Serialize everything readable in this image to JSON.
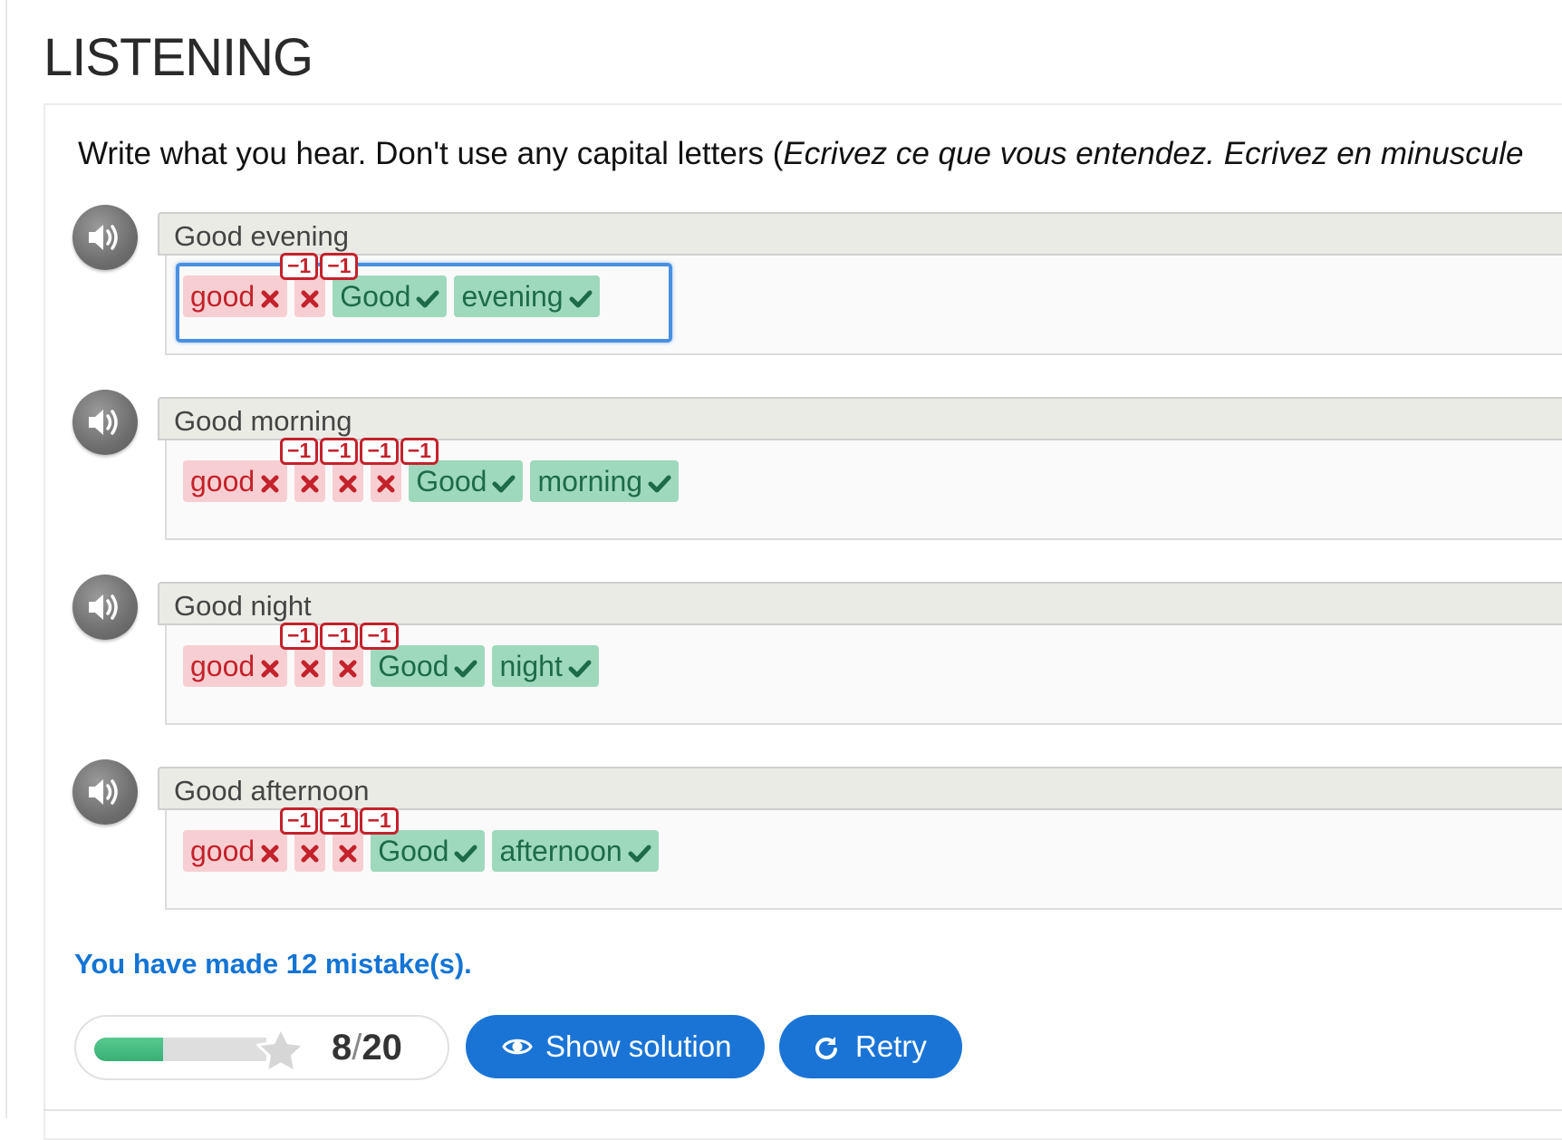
{
  "page": {
    "title": "LISTENING"
  },
  "instructions": {
    "text": "Write what you hear. Don't use any capital letters (",
    "italic": "Ecrivez ce que vous entendez. Ecrivez en minuscule"
  },
  "exercises": [
    {
      "prompt": "Good evening",
      "tokens": [
        {
          "text": "good",
          "status": "wrong"
        },
        {
          "text": "",
          "status": "wrong"
        },
        {
          "text": "Good",
          "status": "correct"
        },
        {
          "text": "evening",
          "status": "correct"
        }
      ],
      "penalties": [
        "−1",
        "−1"
      ]
    },
    {
      "prompt": "Good morning",
      "tokens": [
        {
          "text": "good",
          "status": "wrong"
        },
        {
          "text": "",
          "status": "wrong"
        },
        {
          "text": "",
          "status": "wrong"
        },
        {
          "text": "",
          "status": "wrong"
        },
        {
          "text": "Good",
          "status": "correct"
        },
        {
          "text": "morning",
          "status": "correct"
        }
      ],
      "penalties": [
        "−1",
        "−1",
        "−1",
        "−1"
      ]
    },
    {
      "prompt": "Good night",
      "tokens": [
        {
          "text": "good",
          "status": "wrong"
        },
        {
          "text": "",
          "status": "wrong"
        },
        {
          "text": "",
          "status": "wrong"
        },
        {
          "text": "Good",
          "status": "correct"
        },
        {
          "text": "night",
          "status": "correct"
        }
      ],
      "penalties": [
        "−1",
        "−1",
        "−1"
      ]
    },
    {
      "prompt": "Good afternoon",
      "tokens": [
        {
          "text": "good",
          "status": "wrong"
        },
        {
          "text": "",
          "status": "wrong"
        },
        {
          "text": "",
          "status": "wrong"
        },
        {
          "text": "Good",
          "status": "correct"
        },
        {
          "text": "afternoon",
          "status": "correct"
        }
      ],
      "penalties": [
        "−1",
        "−1",
        "−1"
      ]
    }
  ],
  "icons": {
    "audio": "speaker-icon",
    "wrong": "cross-icon",
    "correct": "check-icon",
    "star": "star-icon",
    "solution": "eye-icon",
    "retry": "refresh-icon"
  },
  "result": {
    "text": "You have made 12 mistake(s)."
  },
  "score": {
    "value": "8",
    "separator": "/",
    "max": "20",
    "progress": 0.4
  },
  "buttons": {
    "show_solution": "Show solution",
    "retry": "Retry"
  },
  "colors": {
    "wrong_bg": "#f7cfd2",
    "wrong_text": "#c3222c",
    "correct_bg": "#9fd9bd",
    "correct_text": "#1e6b47",
    "accent": "#1a74d6",
    "focus": "#4a90e2"
  }
}
